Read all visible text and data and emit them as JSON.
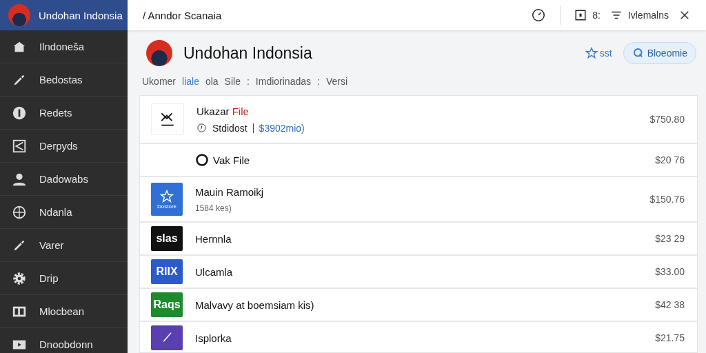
{
  "sidebar": {
    "title": "Undohan Indonsia",
    "items": [
      {
        "label": "Ilndoneša",
        "kind": "home",
        "selected": false
      },
      {
        "label": "Bedostas",
        "kind": "brush",
        "selected": false
      },
      {
        "label": "Redets",
        "kind": "info",
        "selected": false
      },
      {
        "label": "Derpyds",
        "kind": "frame",
        "selected": false
      },
      {
        "label": "Dadowabs",
        "kind": "person",
        "selected": false
      },
      {
        "label": "Ndanla",
        "kind": "globe",
        "selected": false
      },
      {
        "label": "Varer",
        "kind": "brush",
        "selected": false
      },
      {
        "label": "Drip",
        "kind": "gear",
        "selected": false
      },
      {
        "label": "Mlocbean",
        "kind": "panel",
        "selected": false
      },
      {
        "label": "Dnoobdonn",
        "kind": "play",
        "selected": false
      }
    ]
  },
  "topbar": {
    "breadcrumb": "/ Anndor Scanaia",
    "count": "8:",
    "filter_label": "Ivlemalns"
  },
  "page": {
    "title": "Undohan Indonsia",
    "star_label": "sst",
    "button": "Bloeomie",
    "tabs": [
      {
        "label": "Ukomer",
        "selected": false
      },
      {
        "label": "liale",
        "selected": true
      },
      {
        "label": "ola",
        "selected": false
      },
      {
        "label": "Sile",
        "selected": false
      },
      {
        "label": ":",
        "selected": false
      },
      {
        "label": "Imdiorinadas",
        "selected": false
      },
      {
        "label": ":",
        "selected": false
      },
      {
        "label": "Versi",
        "selected": false
      }
    ]
  },
  "rows": [
    {
      "kind": "xmark",
      "title": "Ukazar **File**",
      "meta": "Stdidost",
      "link": "$3902mio)",
      "price": "$750.80"
    },
    {
      "kind": "circle",
      "title": "Vak File",
      "price": "$20 76"
    },
    {
      "kind": "star",
      "thumb_label": "Dostore",
      "color": "#2f6fd6",
      "title": "Mauin Ramoikj",
      "sub": "1584 kes)",
      "price": "$150.76"
    },
    {
      "kind": "logo",
      "thumb_label": "slas",
      "color": "#111111",
      "title": "Hernnla",
      "price": "$23 29"
    },
    {
      "kind": "logo",
      "thumb_label": "RIIX",
      "color": "#2a5bc9",
      "title": "Ulcamla",
      "price": "$33.00"
    },
    {
      "kind": "logo",
      "thumb_label": "Raqs",
      "color": "#1e8a2e",
      "title": "Malvavy at boemsiam kis)",
      "price": "$42 38"
    },
    {
      "kind": "logo",
      "thumb_label": "⟋",
      "color": "#5a3fb0",
      "title": "Isplorka",
      "price": "$21.75"
    }
  ]
}
